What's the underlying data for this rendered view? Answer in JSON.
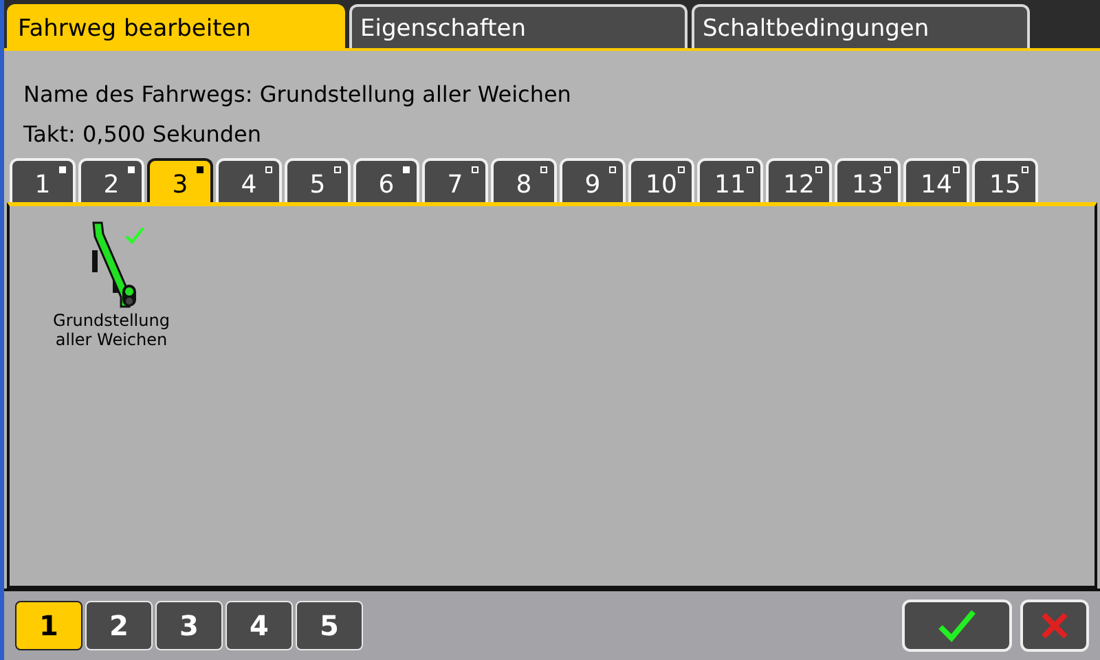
{
  "main_tabs": [
    {
      "label": "Fahrweg bearbeiten",
      "selected": true
    },
    {
      "label": "Eigenschaften",
      "selected": false
    },
    {
      "label": "Schaltbedingungen",
      "selected": false
    }
  ],
  "info": {
    "name_line": "Name des Fahrwegs: Grundstellung aller Weichen",
    "takt_line": "Takt: 0,500 Sekunden"
  },
  "page_tabs": [
    {
      "label": "1",
      "selected": false,
      "used": true
    },
    {
      "label": "2",
      "selected": false,
      "used": true
    },
    {
      "label": "3",
      "selected": true,
      "used": true
    },
    {
      "label": "4",
      "selected": false,
      "used": false
    },
    {
      "label": "5",
      "selected": false,
      "used": false
    },
    {
      "label": "6",
      "selected": false,
      "used": true
    },
    {
      "label": "7",
      "selected": false,
      "used": false
    },
    {
      "label": "8",
      "selected": false,
      "used": false
    },
    {
      "label": "9",
      "selected": false,
      "used": false
    },
    {
      "label": "10",
      "selected": false,
      "used": false
    },
    {
      "label": "11",
      "selected": false,
      "used": false
    },
    {
      "label": "12",
      "selected": false,
      "used": false
    },
    {
      "label": "13",
      "selected": false,
      "used": false
    },
    {
      "label": "14",
      "selected": false,
      "used": false
    },
    {
      "label": "15",
      "selected": false,
      "used": false
    }
  ],
  "items": [
    {
      "label": "Grundstellung aller Weichen",
      "checked": true
    }
  ],
  "pages": [
    {
      "label": "1",
      "selected": true
    },
    {
      "label": "2",
      "selected": false
    },
    {
      "label": "3",
      "selected": false
    },
    {
      "label": "4",
      "selected": false
    },
    {
      "label": "5",
      "selected": false
    }
  ]
}
